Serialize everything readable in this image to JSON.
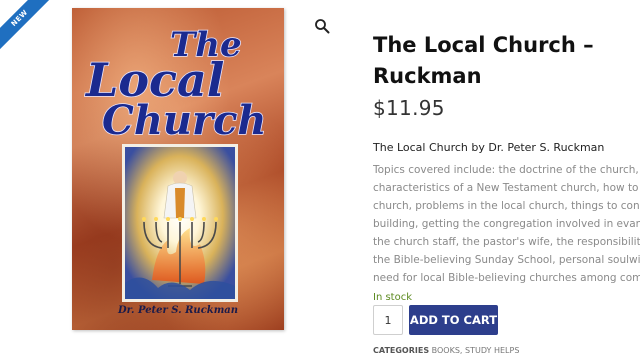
{
  "badge": {
    "label": "NEW",
    "color": "#1f6fc0"
  },
  "product": {
    "title": "The Local Church – Ruckman",
    "price": "$11.95",
    "short_title": "The Local Church by Dr. Peter S. Ruckman",
    "description_lines": [
      "Topics covered include: the doctrine of the church, the",
      "characteristics of a New Testament church, how to start a local",
      "church, problems in the local church, things to consider for a",
      "building, getting the congregation involved in evangelistic out",
      "the church staff, the pastor's wife, the responsibilities for the",
      "the Bible-believing Sunday School, personal soulwinning, and",
      "need for local Bible-believing churches among communities."
    ],
    "stock": "In stock",
    "quantity": "1",
    "add_to_cart": "ADD TO CART",
    "categories_label": "CATEGORIES",
    "categories": "BOOKS, STUDY HELPS"
  },
  "cover": {
    "title_line1": "The",
    "title_line2": "Local",
    "title_line3": "Church",
    "author": "Dr. Peter S. Ruckman"
  },
  "icons": {
    "zoom": "magnifier-icon"
  },
  "colors": {
    "button": "#2d3e8c",
    "stock": "#5c8a1f",
    "cover_title": "#1b2a8f"
  }
}
